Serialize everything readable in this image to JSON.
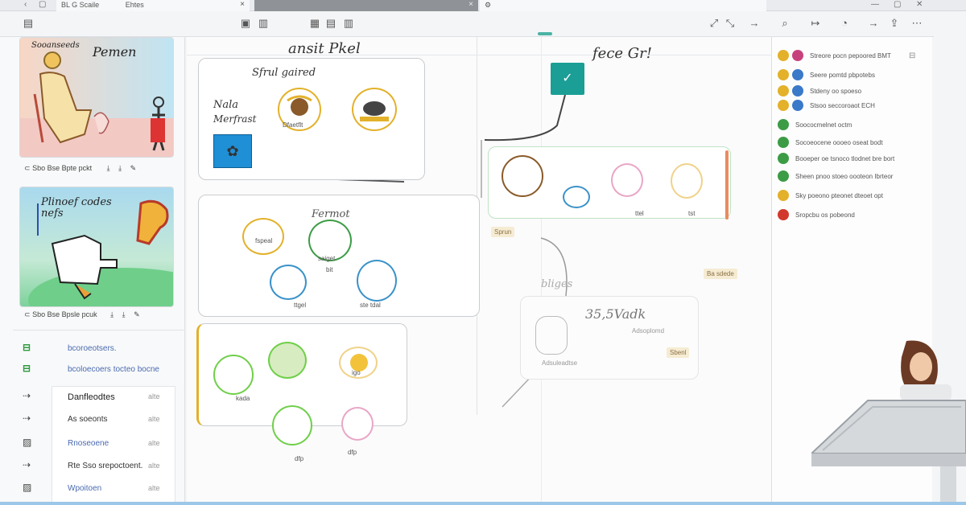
{
  "tabs": [
    {
      "label": "BL G Scaile",
      "label2": "Ehtes"
    },
    {
      "label": ""
    },
    {
      "label": ""
    }
  ],
  "canvas": {
    "title_left": "ansit Pkel",
    "title_right": "fece Gr!",
    "frames": {
      "top_left": {
        "title": "Sfrul gaired",
        "side1": "Nala",
        "side2": "Merfrast",
        "node_a": "Dfaetflt"
      },
      "middle": {
        "title": "Fermot",
        "node_a": "fspeal",
        "node_b": "saiget",
        "node_c": "bit",
        "node_d": "ttgel",
        "node_e": "ste tdal"
      },
      "bottom": {
        "node_a": "kada",
        "node_b": "igo",
        "node_c": "dfp"
      },
      "right_top": {
        "lbl_a": "ttel",
        "lbl_b": "tst"
      },
      "sketch": {
        "text": "35,5Vadk",
        "sub": "Adsoplomd",
        "note": "Adsuleadtse"
      }
    },
    "labels": {
      "handwritten_center": "bliges",
      "sticky_a": "Sprun",
      "sticky_b": "Ba sdede",
      "sticky_c": "Sbenl"
    }
  },
  "sidebar": {
    "cards": [
      {
        "caption": "Sooanseeds",
        "title": "Pemen",
        "meta": "Sbo Bse Bpte pckt"
      },
      {
        "caption": "Plinoef codes nefs",
        "title": "",
        "meta": "Sbo Bse Bpsle pcuk"
      }
    ],
    "items": [
      {
        "label": "bcoroeotsers.",
        "suffix": ""
      },
      {
        "label": "bcoloecoers tocteo bocne",
        "suffix": ""
      },
      {
        "label": "Danfleodtes",
        "suffix": "alte"
      },
      {
        "label": "As soeonts",
        "suffix": "alte"
      },
      {
        "label": "Rnoseoene",
        "suffix": "alte"
      },
      {
        "label": "Rte Sso srepoctoent.",
        "suffix": "alte"
      },
      {
        "label": "Wpoitoen",
        "suffix": "alte"
      }
    ]
  },
  "rpanel": {
    "rows": [
      {
        "label": "Streore pocn pepoored BMT",
        "color": "#e3b12a",
        "color2": "#c7427c"
      },
      {
        "label": "Seere pomtd pbpotebs",
        "color": "#e3b12a",
        "color2": "#3b79c9"
      },
      {
        "label": "Stdeny oo spoeso",
        "color": "#e3b12a",
        "color2": "#3b79c9"
      },
      {
        "label": "Stsoo seccoroaot ECH",
        "color": "#e3b12a",
        "color2": "#3b79c9"
      },
      {
        "label": "Soococmelnet octm",
        "color": "#3c9c45",
        "color2": ""
      },
      {
        "label": "Socoeocene oooeo oseat bodt",
        "color": "#3c9c45",
        "color2": ""
      },
      {
        "label": "Booeper oe tsnoco tlodnet bre bort",
        "color": "#3c9c45",
        "color2": ""
      },
      {
        "label": "Sheen pnoo stoeo oooteon Ibrteor",
        "color": "#3c9c45",
        "color2": ""
      },
      {
        "label": "Sky poeono pteonet dteoet opt",
        "color": "#e3b12a",
        "color2": ""
      },
      {
        "label": "Sropcbu os pobeond",
        "color": "#d2392d",
        "color2": ""
      }
    ]
  }
}
